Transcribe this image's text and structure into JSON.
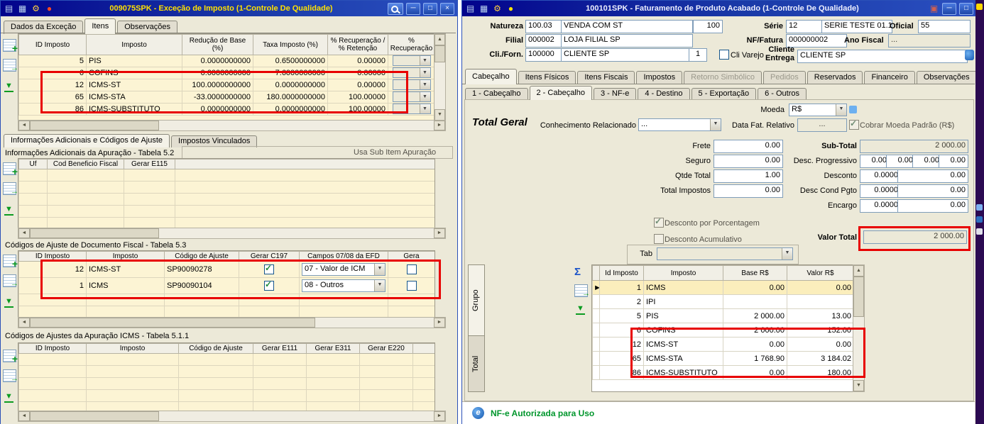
{
  "colors": {
    "highlight_red": "#e80000",
    "titlebar_blue": "#02038c",
    "row_cream": "#fcf4d4",
    "status_green": "#00962c"
  },
  "left": {
    "title": "009075SPK - Exceção de Imposto (1-Controle De Qualidade)",
    "tabs": [
      "Dados da Exceção",
      "Itens",
      "Observações"
    ],
    "grid1": {
      "headers": [
        "ID Imposto",
        "Imposto",
        "Redução de Base (%)",
        "Taxa Imposto (%)",
        "% Recuperação / % Retenção",
        "% Recuperação"
      ],
      "rows": [
        [
          "5",
          "PIS",
          "0.0000000000",
          "0.6500000000",
          "0.00000"
        ],
        [
          "6",
          "COFINS",
          "0.0000000000",
          "7.6000000000",
          "0.00000"
        ],
        [
          "12",
          "ICMS-ST",
          "100.0000000000",
          "0.0000000000",
          "0.00000"
        ],
        [
          "65",
          "ICMS-STA",
          "-33.0000000000",
          "180.0000000000",
          "100.00000"
        ],
        [
          "86",
          "ICMS-SUBSTITUTO",
          "0.0000000000",
          "0.0000000000",
          "100.00000"
        ]
      ]
    },
    "section_tabs": [
      "Informações Adicionais e Códigos de Ajuste",
      "Impostos Vinculados"
    ],
    "sec1": {
      "title": "Informações Adicionais da Apuração - Tabela 5.2",
      "right_label": "Usa Sub Item Apuração",
      "headers": [
        "Uf",
        "Cod Beneficio Fiscal",
        "Gerar E115"
      ]
    },
    "sec2": {
      "title": "Códigos de Ajuste de Documento Fiscal - Tabela 5.3",
      "headers": [
        "ID Imposto",
        "Imposto",
        "Código de Ajuste",
        "Gerar C197",
        "Campos 07/08 da EFD",
        "Gera"
      ],
      "rows": [
        [
          "12",
          "ICMS-ST",
          "SP90090278",
          "07 - Valor de ICM"
        ],
        [
          "1",
          "ICMS",
          "SP90090104",
          "08 - Outros"
        ]
      ]
    },
    "sec3": {
      "title": "Códigos de Ajustes da Apuração ICMS - Tabela 5.1.1",
      "headers": [
        "ID Imposto",
        "Imposto",
        "Código de Ajuste",
        "Gerar E111",
        "Gerar E311",
        "Gerar E220"
      ]
    }
  },
  "right": {
    "title": "100101SPK - Faturamento de Produto Acabado (1-Controle De Qualidade)",
    "form": {
      "natureza_label": "Natureza",
      "natureza_code": "100.03",
      "natureza_desc": "VENDA COM ST",
      "natureza_extra": "100",
      "serie_label": "Série",
      "serie_code": "12",
      "serie_desc": "SERIE TESTE 01.1",
      "oficial_label": "Oficial",
      "oficial_value": "55",
      "filial_label": "Filial",
      "filial_code": "000002",
      "filial_desc": "LOJA FILIAL SP",
      "nf_label": "NF/Fatura",
      "nf_value": "000000002",
      "ano_label": "Ano Fiscal",
      "ano_value": "...",
      "cli_label": "Cli./Forn.",
      "cli_code": "100000",
      "cli_desc": "CLIENTE SP",
      "cli_loja": "1",
      "cli_varejo_label": "Cli Varejo",
      "entrega_label": "Cliente\nEntrega",
      "entrega_value": "CLIENTE SP"
    },
    "tabs": [
      "Cabeçalho",
      "Itens Físicos",
      "Itens Fiscais",
      "Impostos",
      "Retorno Simbólico",
      "Pedidos",
      "Reservados",
      "Financeiro",
      "Observações"
    ],
    "subtabs": [
      "1 - Cabeçalho",
      "2 - Cabeçalho",
      "3 - NF-e",
      "4 - Destino",
      "5 - Exportação",
      "6 - Outros"
    ],
    "moeda_label": "Moeda",
    "moeda_value": "R$",
    "total_geral_label": "Total Geral",
    "conhecimento_label": "Conhecimento Relacionado",
    "conhecimento_value": "...",
    "data_fat_label": "Data Fat. Relativo",
    "data_fat_value": "...",
    "cobrar_moeda_label": "Cobrar Moeda Padrão (R$)",
    "totals": {
      "frete_label": "Frete",
      "frete_value": "0.00",
      "seguro_label": "Seguro",
      "seguro_value": "0.00",
      "qtde_label": "Qtde Total",
      "qtde_value": "1.00",
      "impostos_label": "Total Impostos",
      "impostos_value": "0.00",
      "subtotal_label": "Sub-Total",
      "subtotal_value": "2 000.00",
      "desc_prog_label": "Desc. Progressivo",
      "desc_prog_values": [
        "0.00",
        "0.00",
        "0.00",
        "0.00"
      ],
      "desconto_label": "Desconto",
      "desconto_pct": "0.0000",
      "desconto_value": "0.00",
      "desc_cond_label": "Desc Cond Pgto",
      "desc_cond_pct": "0.0000",
      "desc_cond_value": "0.00",
      "encargo_label": "Encargo",
      "encargo_pct": "0.0000",
      "encargo_value": "0.00",
      "valor_total_label": "Valor Total",
      "valor_total_value": "2 000.00"
    },
    "check_porcentagem_label": "Desconto por Porcentagem",
    "check_acumulativo_label": "Desconto Acumulativo",
    "tab_label": "Tab",
    "side_tabs": [
      "Grupo",
      "Total"
    ],
    "grid": {
      "headers": [
        "Id Imposto",
        "Imposto",
        "Base R$",
        "Valor R$"
      ],
      "rows": [
        [
          "1",
          "ICMS",
          "0.00",
          "0.00"
        ],
        [
          "2",
          "IPI",
          "",
          ""
        ],
        [
          "5",
          "PIS",
          "2 000.00",
          "13.00"
        ],
        [
          "6",
          "COFINS",
          "2 000.00",
          "152.00"
        ],
        [
          "12",
          "ICMS-ST",
          "0.00",
          "0.00"
        ],
        [
          "65",
          "ICMS-STA",
          "1 768.90",
          "3 184.02"
        ],
        [
          "86",
          "ICMS-SUBSTITUTO",
          "0.00",
          "180.00"
        ]
      ]
    },
    "status_text": "NF-e Autorizada para Uso"
  }
}
